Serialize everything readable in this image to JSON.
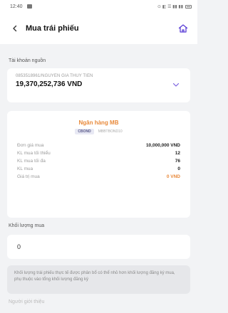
{
  "status_bar": {
    "time": "12:40",
    "right_text": "⊙ ◧ ☰ ▮▮ ▮▮"
  },
  "header": {
    "title": "Mua trái phiếu"
  },
  "source_account": {
    "label": "Tài khoản nguồn",
    "account_line": "0853518961/NGUYEN GIA THUY TIEN",
    "balance": "19,370,252,736 VND"
  },
  "bond": {
    "bank_name": "Ngân hàng MB",
    "code": "CBOND",
    "bond_id": "MBBTBOND10",
    "rows": [
      {
        "label": "Đơn giá mua",
        "value": "10,000,000 VND"
      },
      {
        "label": "KL mua tối thiểu",
        "value": "12"
      },
      {
        "label": "KL mua tối đa",
        "value": "76"
      },
      {
        "label": "KL mua",
        "value": "0"
      },
      {
        "label": "Giá trị mua",
        "value": "0 VND"
      }
    ]
  },
  "quantity": {
    "label": "Khối lượng mua",
    "value": "0"
  },
  "note": "Khối lượng trái phiếu thực tế được phân bổ có thể nhỏ hơn khối lượng đăng ký mua, phụ thuộc vào tổng khối lượng đăng ký",
  "referrer": {
    "label": "Người giới thiệu"
  },
  "colors": {
    "accent": "#5b3fd6",
    "orange": "#e8893a"
  }
}
